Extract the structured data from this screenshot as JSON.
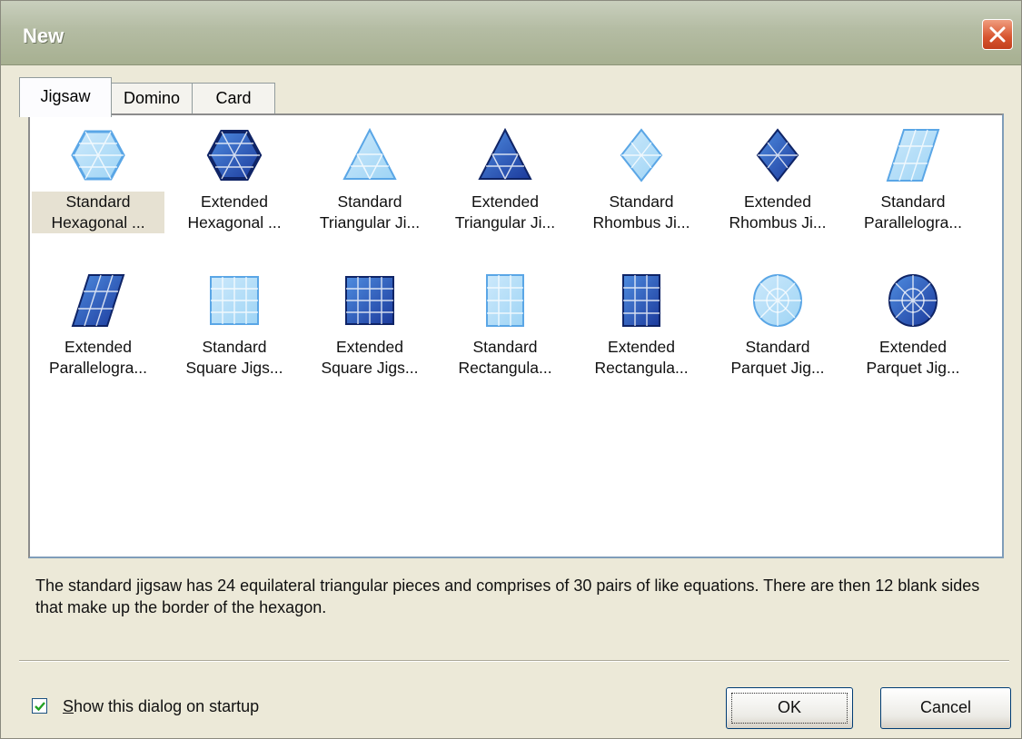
{
  "window": {
    "title": "New"
  },
  "tabs": [
    {
      "label": "Jigsaw",
      "active": true
    },
    {
      "label": "Domino",
      "active": false
    },
    {
      "label": "Card",
      "active": false
    }
  ],
  "items": [
    {
      "line1": "Standard",
      "line2": "Hexagonal ...",
      "icon": "hexagon-icon",
      "selected": true
    },
    {
      "line1": "Extended",
      "line2": "Hexagonal ...",
      "icon": "hexagon-dark-icon"
    },
    {
      "line1": "Standard",
      "line2": "Triangular Ji...",
      "icon": "triangle-icon"
    },
    {
      "line1": "Extended",
      "line2": "Triangular Ji...",
      "icon": "triangle-dark-icon"
    },
    {
      "line1": "Standard",
      "line2": "Rhombus Ji...",
      "icon": "rhombus-icon"
    },
    {
      "line1": "Extended",
      "line2": "Rhombus Ji...",
      "icon": "rhombus-dark-icon"
    },
    {
      "line1": "Standard",
      "line2": "Parallelogra...",
      "icon": "parallelogram-icon"
    },
    {
      "line1": "Extended",
      "line2": "Parallelogra...",
      "icon": "parallelogram-dark-icon"
    },
    {
      "line1": "Standard",
      "line2": "Square Jigs...",
      "icon": "square-icon"
    },
    {
      "line1": "Extended",
      "line2": "Square Jigs...",
      "icon": "square-dark-icon"
    },
    {
      "line1": "Standard",
      "line2": "Rectangula...",
      "icon": "rectangle-icon"
    },
    {
      "line1": "Extended",
      "line2": "Rectangula...",
      "icon": "rectangle-dark-icon"
    },
    {
      "line1": "Standard",
      "line2": "Parquet Jig...",
      "icon": "parquet-icon"
    },
    {
      "line1": "Extended",
      "line2": "Parquet Jig...",
      "icon": "parquet-dark-icon"
    }
  ],
  "description": "The standard jigsaw has 24 equilateral triangular pieces and comprises of 30 pairs of like equations. There are then 12 blank sides that make up the border of the hexagon.",
  "startup_checkbox": {
    "label": "Show this dialog on startup",
    "checked": true
  },
  "buttons": {
    "ok": "OK",
    "cancel": "Cancel"
  },
  "colors": {
    "accent_light": "#7fc3f0",
    "accent_dark": "#1f3f9a",
    "selection_bg": "#e6e1d2"
  }
}
